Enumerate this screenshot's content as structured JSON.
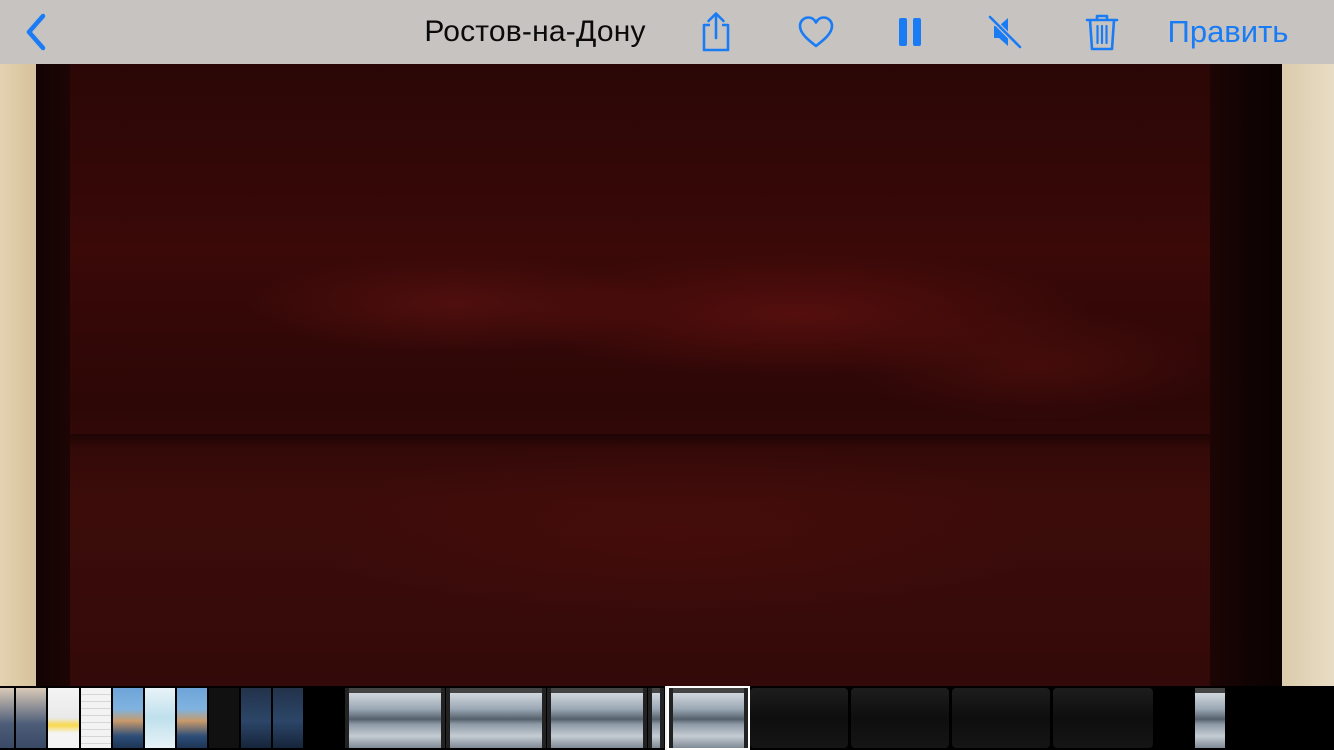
{
  "navbar": {
    "back_icon": "chevron-left-icon",
    "title": "Ростов-на-Дону",
    "share_icon": "share-icon",
    "favorite_icon": "heart-icon",
    "pause_icon": "pause-icon",
    "mute_icon": "speaker-muted-icon",
    "trash_icon": "trash-icon",
    "edit_label": "Править"
  },
  "photo": {
    "description_icon": "live-photo-red-monitor"
  },
  "filmstrip": {
    "thumbnails": [
      {
        "kind": "child"
      },
      {
        "kind": "child"
      },
      {
        "kind": "doc"
      },
      {
        "kind": "list"
      },
      {
        "kind": "catalina"
      },
      {
        "kind": "arrows"
      },
      {
        "kind": "catalina"
      },
      {
        "kind": "dark"
      },
      {
        "kind": "dim"
      },
      {
        "kind": "dim"
      },
      {
        "kind": "sea"
      },
      {
        "kind": "sea"
      },
      {
        "kind": "sea"
      },
      {
        "kind": "sea"
      },
      {
        "kind": "sea"
      },
      {
        "kind": "blackscreen"
      },
      {
        "kind": "blackscreen"
      },
      {
        "kind": "blackscreen"
      },
      {
        "kind": "blackscreen"
      },
      {
        "kind": "sea"
      }
    ]
  },
  "colors": {
    "accent": "#1a7cf5",
    "navbar_bg": "#c7c3c1",
    "title_text": "#0a0a0a"
  }
}
